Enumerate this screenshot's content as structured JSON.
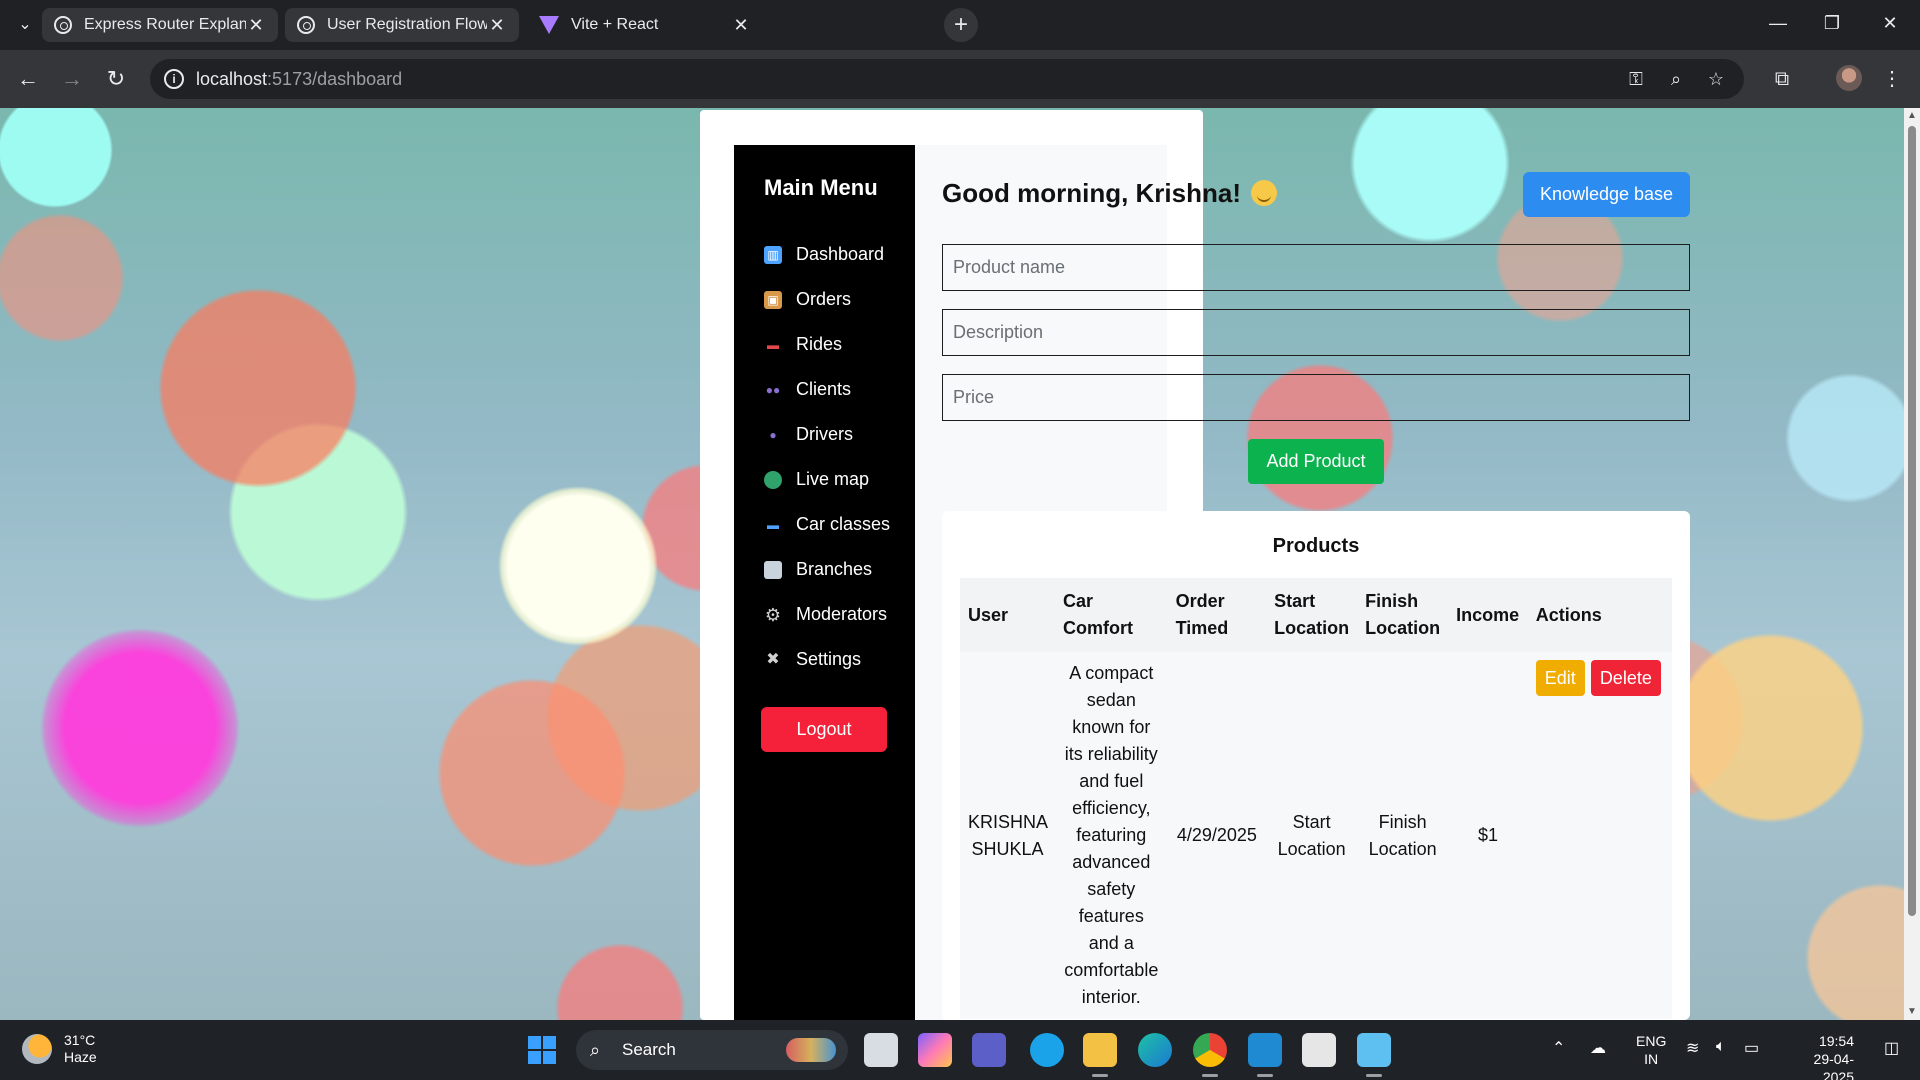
{
  "browser": {
    "tabs": [
      {
        "title": "Express Router Explanation",
        "icon": "openai-icon"
      },
      {
        "title": "User Registration Flow",
        "icon": "openai-icon"
      },
      {
        "title": "Vite + React",
        "icon": "vite-icon",
        "active": true
      }
    ],
    "url_host": "localhost",
    "url_path": ":5173/dashboard"
  },
  "sidebar": {
    "title": "Main Menu",
    "items": [
      {
        "label": "Dashboard",
        "icon": "chart-icon"
      },
      {
        "label": "Orders",
        "icon": "package-icon"
      },
      {
        "label": "Rides",
        "icon": "car-icon"
      },
      {
        "label": "Clients",
        "icon": "people-icon"
      },
      {
        "label": "Drivers",
        "icon": "person-icon"
      },
      {
        "label": "Live map",
        "icon": "globe-icon"
      },
      {
        "label": "Car classes",
        "icon": "car-icon"
      },
      {
        "label": "Branches",
        "icon": "building-icon"
      },
      {
        "label": "Moderators",
        "icon": "gear-icon"
      },
      {
        "label": "Settings",
        "icon": "tools-icon"
      }
    ],
    "logout_label": "Logout"
  },
  "main": {
    "greeting": "Good morning, Krishna!",
    "knowledge_base_label": "Knowledge base",
    "form": {
      "product_name_placeholder": "Product name",
      "description_placeholder": "Description",
      "price_placeholder": "Price",
      "add_button_label": "Add Product"
    }
  },
  "products": {
    "title": "Products",
    "columns": [
      "User",
      "Car Comfort",
      "Order Timed",
      "Start Location",
      "Finish Location",
      "Income",
      "Actions"
    ],
    "rows": [
      {
        "user": "KRISHNA SHUKLA",
        "car_comfort": "A compact sedan known for its reliability and fuel efficiency, featuring advanced safety features and a comfortable interior.",
        "order_timed": "4/29/2025",
        "start_location": "Start Location",
        "finish_location": "Finish Location",
        "income": "$1",
        "edit_label": "Edit",
        "delete_label": "Delete"
      }
    ]
  },
  "taskbar": {
    "temperature": "31°C",
    "weather": "Haze",
    "search_label": "Search",
    "lang_line1": "ENG",
    "lang_line2": "IN",
    "time": "19:54",
    "date": "29-04-2025"
  },
  "colors": {
    "sidebar_bg": "#000000",
    "logout": "#f5213a",
    "knowledge_base": "#2d8cf0",
    "add_product": "#0bb24d",
    "edit": "#f0ad00",
    "delete": "#ef2437"
  }
}
